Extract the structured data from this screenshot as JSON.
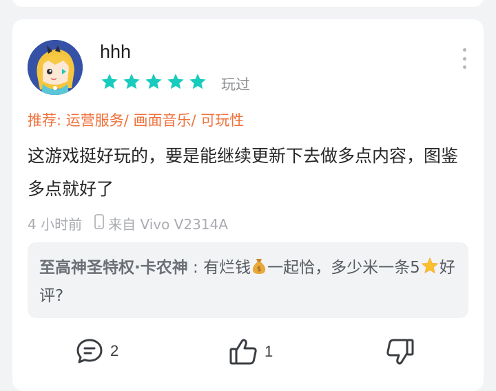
{
  "review": {
    "username": "hhh",
    "rating": 5,
    "rating_max": 5,
    "star_color": "#17cbbd",
    "played_label": "玩过",
    "recommend_prefix": "推荐: ",
    "recommend_tags": "运营服务/ 画面音乐/ 可玩性",
    "content": "这游戏挺好玩的，要是能继续更新下去做多点内容，图鉴多点就好了",
    "time": "4 小时前",
    "device": "来自 Vivo V2314A"
  },
  "reply": {
    "author": "至高神圣特权·卡农神",
    "separator": " : ",
    "text_part1": "有烂钱",
    "text_part2": "一起恰，多少米一条5",
    "text_part3": "好评?"
  },
  "actions": {
    "comment_count": "2",
    "like_count": "1"
  },
  "colors": {
    "accent_orange": "#f0713a",
    "star_teal": "#17cbbd"
  }
}
